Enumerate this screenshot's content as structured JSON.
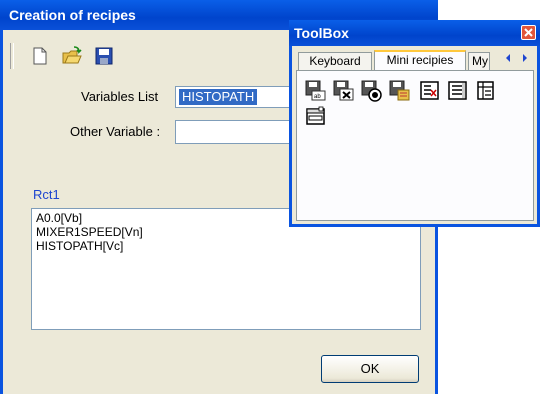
{
  "main_window": {
    "title": "Creation of recipes",
    "toolbar": {
      "icons": [
        "new-file-icon",
        "open-folder-icon",
        "save-disk-icon"
      ]
    },
    "variables_list": {
      "label": "Variables List",
      "selected": "HISTOPATH"
    },
    "other_variable": {
      "label": "Other Variable :",
      "value": ""
    },
    "recipe": {
      "name": "Rct1",
      "lines": [
        "A0.0[Vb]",
        "MIXER1SPEED[Vn]",
        "HISTOPATH[Vc]"
      ]
    },
    "ok_label": "OK"
  },
  "toolbox": {
    "title": "ToolBox",
    "tabs": [
      {
        "label": "Keyboard"
      },
      {
        "label": "Mini recipies"
      },
      {
        "label": "My"
      }
    ],
    "active_tab": "Mini recipies",
    "tools": [
      "save-field-icon",
      "delete-recipe-icon",
      "record-recipe-icon",
      "load-recipe-icon",
      "recipe-list-delete-icon",
      "recipe-list-icon",
      "recipe-table-icon",
      "recipe-combo-icon"
    ]
  },
  "colors": {
    "titlebar": "#0a54e0",
    "selection": "#316ac5",
    "window_bg": "#ece9d8",
    "label_blue": "#1e46d0"
  }
}
